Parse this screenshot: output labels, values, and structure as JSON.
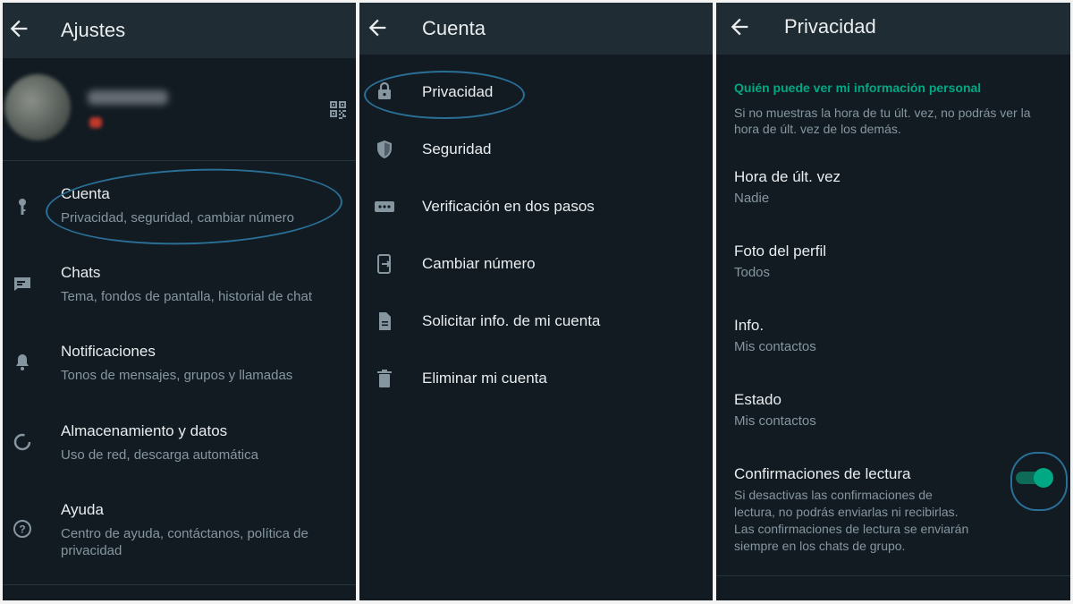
{
  "panel1": {
    "title": "Ajustes",
    "items": [
      {
        "title": "Cuenta",
        "subtitle": "Privacidad, seguridad, cambiar número",
        "icon": "key-icon"
      },
      {
        "title": "Chats",
        "subtitle": "Tema, fondos de pantalla, historial de chat",
        "icon": "chat-icon"
      },
      {
        "title": "Notificaciones",
        "subtitle": "Tonos de mensajes, grupos y llamadas",
        "icon": "bell-icon"
      },
      {
        "title": "Almacenamiento y datos",
        "subtitle": "Uso de red, descarga automática",
        "icon": "data-usage-icon"
      },
      {
        "title": "Ayuda",
        "subtitle_line1": "Centro de ayuda, contáctanos, política de",
        "subtitle_line2": "privacidad",
        "icon": "help-icon"
      }
    ]
  },
  "panel2": {
    "title": "Cuenta",
    "items": [
      {
        "label": "Privacidad",
        "icon": "lock-icon"
      },
      {
        "label": "Seguridad",
        "icon": "shield-icon"
      },
      {
        "label": "Verificación en dos pasos",
        "icon": "dots-icon"
      },
      {
        "label": "Cambiar número",
        "icon": "phone-change-icon"
      },
      {
        "label": "Solicitar info. de mi cuenta",
        "icon": "document-icon"
      },
      {
        "label": "Eliminar mi cuenta",
        "icon": "trash-icon"
      }
    ]
  },
  "panel3": {
    "title": "Privacidad",
    "section_header": "Quién puede ver mi información personal",
    "section_desc_line1": "Si no muestras la hora de tu últ. vez, no podrás ver la",
    "section_desc_line2": "hora de últ. vez de los demás.",
    "items": [
      {
        "title": "Hora de últ. vez",
        "value": "Nadie"
      },
      {
        "title": "Foto del perfil",
        "value": "Todos"
      },
      {
        "title": "Info.",
        "value": "Mis contactos"
      },
      {
        "title": "Estado",
        "value": "Mis contactos"
      }
    ],
    "read_receipts": {
      "title": "Confirmaciones de lectura",
      "desc_line1": "Si desactivas las confirmaciones de",
      "desc_line2": "lectura, no podrás enviarlas ni recibirlas.",
      "desc_line3": "Las confirmaciones de lectura se enviarán",
      "desc_line4": "siempre en los chats de grupo.",
      "enabled": true
    }
  },
  "colors": {
    "background": "#121b22",
    "appbar": "#1f2c33",
    "accent": "#00a884",
    "annotation": "#2a6f96"
  }
}
